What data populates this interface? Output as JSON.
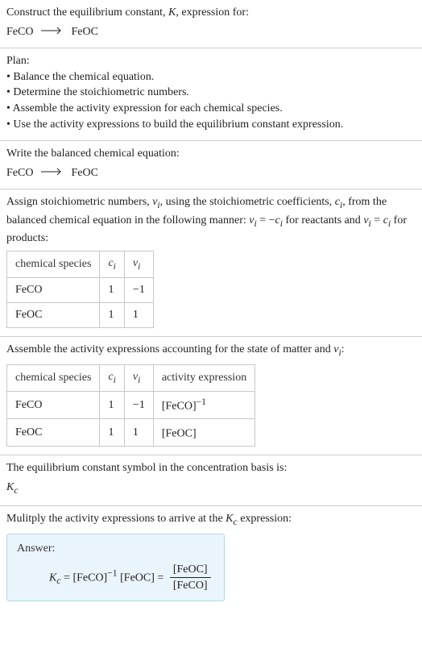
{
  "intro": {
    "line1": "Construct the equilibrium constant, ",
    "K": "K",
    "line1b": ", expression for:",
    "reactant": "FeCO",
    "product": "FeOC"
  },
  "plan": {
    "heading": "Plan:",
    "b1": "• Balance the chemical equation.",
    "b2": "• Determine the stoichiometric numbers.",
    "b3": "• Assemble the activity expression for each chemical species.",
    "b4": "• Use the activity expressions to build the equilibrium constant expression."
  },
  "balanced": {
    "heading": "Write the balanced chemical equation:",
    "reactant": "FeCO",
    "product": "FeOC"
  },
  "assign": {
    "para_a": "Assign stoichiometric numbers, ",
    "nu": "ν",
    "para_b": ", using the stoichiometric coefficients, ",
    "c": "c",
    "para_c": ", from the balanced chemical equation in the following manner: ",
    "rel1a": "ν",
    "rel1b": " = −",
    "rel1c": "c",
    "para_d": " for reactants and ",
    "rel2a": "ν",
    "rel2b": " = ",
    "rel2c": "c",
    "para_e": " for products:",
    "table": {
      "h1": "chemical species",
      "h2": "c",
      "h3": "ν",
      "r1": {
        "sp": "FeCO",
        "c": "1",
        "nu": "−1"
      },
      "r2": {
        "sp": "FeOC",
        "c": "1",
        "nu": "1"
      }
    }
  },
  "assemble": {
    "para_a": "Assemble the activity expressions accounting for the state of matter and ",
    "nu": "ν",
    "para_b": ":",
    "table": {
      "h1": "chemical species",
      "h2": "c",
      "h3": "ν",
      "h4": "activity expression",
      "r1": {
        "sp": "FeCO",
        "c": "1",
        "nu": "−1",
        "act": "[FeCO]",
        "exp": "−1"
      },
      "r2": {
        "sp": "FeOC",
        "c": "1",
        "nu": "1",
        "act": "[FeOC]",
        "exp": ""
      }
    }
  },
  "symbol": {
    "line": "The equilibrium constant symbol in the concentration basis is:",
    "Kc_K": "K",
    "Kc_c": "c"
  },
  "multiply": {
    "line_a": "Mulitply the activity expressions to arrive at the ",
    "K": "K",
    "c": "c",
    "line_b": " expression:"
  },
  "answer": {
    "label": "Answer:",
    "K": "K",
    "c": "c",
    "eq": " = ",
    "t1": "[FeCO]",
    "t1exp": "−1",
    "sp": " ",
    "t2": "[FeOC]",
    "eq2": " = ",
    "num": "[FeOC]",
    "den": "[FeCO]"
  }
}
